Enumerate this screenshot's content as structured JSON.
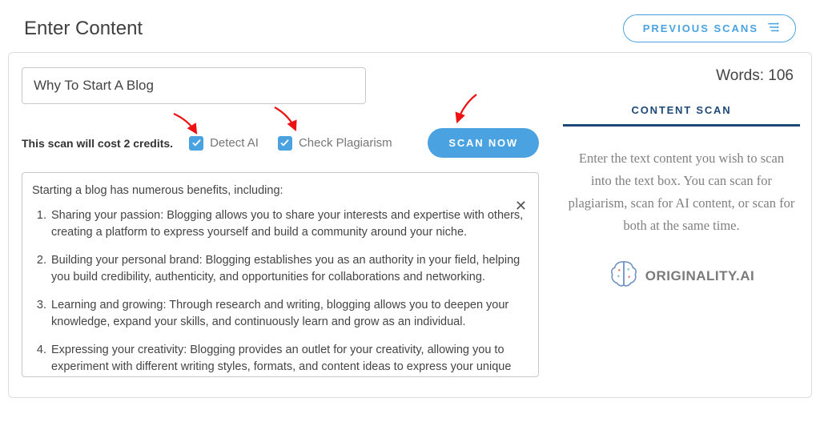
{
  "header": {
    "title": "Enter Content",
    "previous_scans_label": "PREVIOUS SCANS"
  },
  "form": {
    "title_value": "Why To Start A Blog",
    "cost_label": "This scan will cost 2 credits.",
    "detect_ai_label": "Detect AI",
    "check_plagiarism_label": "Check Plagiarism",
    "scan_button_label": "SCAN NOW",
    "detect_ai_checked": true,
    "check_plagiarism_checked": true
  },
  "content": {
    "intro": "Starting a blog has numerous benefits, including:",
    "items": [
      "Sharing your passion: Blogging allows you to share your interests and expertise with others, creating a platform to express yourself and build a community around your niche.",
      "Building your personal brand: Blogging establishes you as an authority in your field, helping you build credibility, authenticity, and opportunities for collaborations and networking.",
      "Learning and growing: Through research and writing, blogging allows you to deepen your knowledge, expand your skills, and continuously learn and grow as an individual.",
      "Expressing your creativity: Blogging provides an outlet for your creativity, allowing you to experiment with different writing styles, formats, and content ideas to express your unique voice."
    ]
  },
  "sidebar": {
    "word_count_label": "Words:",
    "word_count_value": "106",
    "tab_label": "CONTENT SCAN",
    "help_text": "Enter the text content you wish to scan into the text box. You can scan for plagiarism, scan for AI content, or scan for both at the same time.",
    "logo_text": "ORIGINALITY.AI"
  },
  "colors": {
    "accent": "#4aa3e0",
    "tab_accent": "#1e4976",
    "annotation_red": "#e11"
  }
}
